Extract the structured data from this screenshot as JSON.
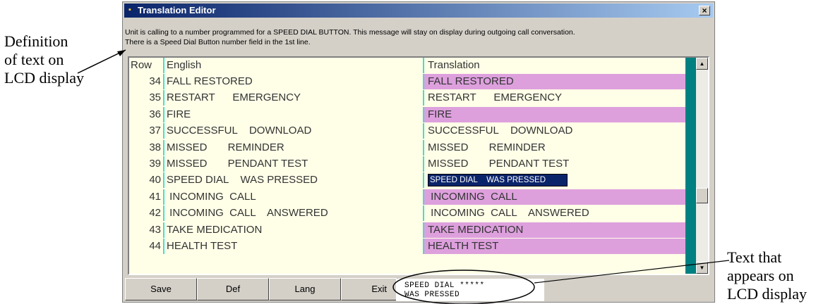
{
  "annotations": {
    "left_lines": [
      "Definition",
      "of text on",
      "LCD display"
    ],
    "right_lines": [
      "Text that",
      "appears on",
      "LCD display"
    ]
  },
  "window": {
    "title": "Translation Editor",
    "close_label": "×",
    "description_lines": [
      "Unit is calling to a number programmed for a SPEED DIAL BUTTON.  This message will stay on display during outgoing call conversation.",
      "There is a Speed Dial Button number field in the 1st line."
    ]
  },
  "grid": {
    "columns": [
      "Row",
      "English",
      "Translation"
    ],
    "rows": [
      {
        "row": "34",
        "english": "FALL RESTORED",
        "translation": "FALL RESTORED",
        "highlight": "pink"
      },
      {
        "row": "35",
        "english": "RESTART      EMERGENCY",
        "translation": "RESTART      EMERGENCY",
        "highlight": "none"
      },
      {
        "row": "36",
        "english": "FIRE",
        "translation": "FIRE",
        "highlight": "pink"
      },
      {
        "row": "37",
        "english": "SUCCESSFUL    DOWNLOAD",
        "translation": "SUCCESSFUL    DOWNLOAD",
        "highlight": "none"
      },
      {
        "row": "38",
        "english": "MISSED       REMINDER",
        "translation": "MISSED       REMINDER",
        "highlight": "none"
      },
      {
        "row": "39",
        "english": "MISSED       PENDANT TEST",
        "translation": "MISSED       PENDANT TEST",
        "highlight": "none"
      },
      {
        "row": "40",
        "english": "SPEED DIAL    WAS PRESSED",
        "translation": "SPEED DIAL    WAS PRESSED",
        "highlight": "selected"
      },
      {
        "row": "41",
        "english": " INCOMING  CALL",
        "translation": " INCOMING  CALL",
        "highlight": "pink"
      },
      {
        "row": "42",
        "english": " INCOMING  CALL    ANSWERED",
        "translation": " INCOMING  CALL    ANSWERED",
        "highlight": "none"
      },
      {
        "row": "43",
        "english": "TAKE MEDICATION",
        "translation": "TAKE MEDICATION",
        "highlight": "pink"
      },
      {
        "row": "44",
        "english": "HEALTH TEST",
        "translation": "HEALTH TEST",
        "highlight": "pink"
      }
    ]
  },
  "buttons": {
    "save": "Save",
    "def": "Def",
    "lang": "Lang",
    "exit": "Exit"
  },
  "lcd": {
    "line1": "SPEED DIAL *****",
    "line2": "WAS PRESSED"
  },
  "colors": {
    "pink": "#dda0dd",
    "selected_bg": "#0a246a",
    "teal": "#008080",
    "grid_bg": "#ffffe8"
  }
}
